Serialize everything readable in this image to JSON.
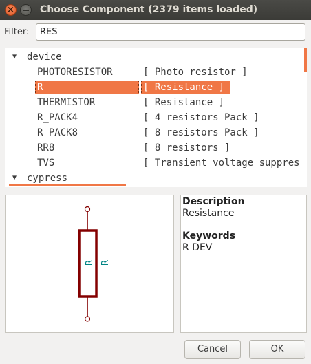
{
  "window": {
    "title": "Choose Component (2379 items loaded)"
  },
  "filter": {
    "label": "Filter:",
    "value": "RES"
  },
  "tree": {
    "groups": [
      {
        "label": "device",
        "expanded": true
      },
      {
        "label": "cypress",
        "expanded": true
      }
    ],
    "items": [
      {
        "name": "PHOTORESISTOR",
        "desc": "[ Photo resistor ]"
      },
      {
        "name": "R",
        "desc": "[ Resistance ]",
        "selected": true
      },
      {
        "name": "THERMISTOR",
        "desc": "[ Resistance ]"
      },
      {
        "name": "R_PACK4",
        "desc": "[ 4 resistors Pack ]"
      },
      {
        "name": "R_PACK8",
        "desc": "[ 8 resistors Pack ]"
      },
      {
        "name": "RR8",
        "desc": "[ 8 resistors ]"
      },
      {
        "name": "TVS",
        "desc": "[ Transient voltage suppres"
      }
    ]
  },
  "preview": {
    "ref_label": "R",
    "value_label": "R",
    "body_color": "#840000",
    "text_color": "#008484"
  },
  "info": {
    "description_heading": "Description",
    "description": "Resistance",
    "keywords_heading": "Keywords",
    "keywords": "R DEV"
  },
  "buttons": {
    "cancel": "Cancel",
    "ok": "OK"
  },
  "colors": {
    "selection": "#f07746",
    "titlebar": "#3f3f3b"
  }
}
